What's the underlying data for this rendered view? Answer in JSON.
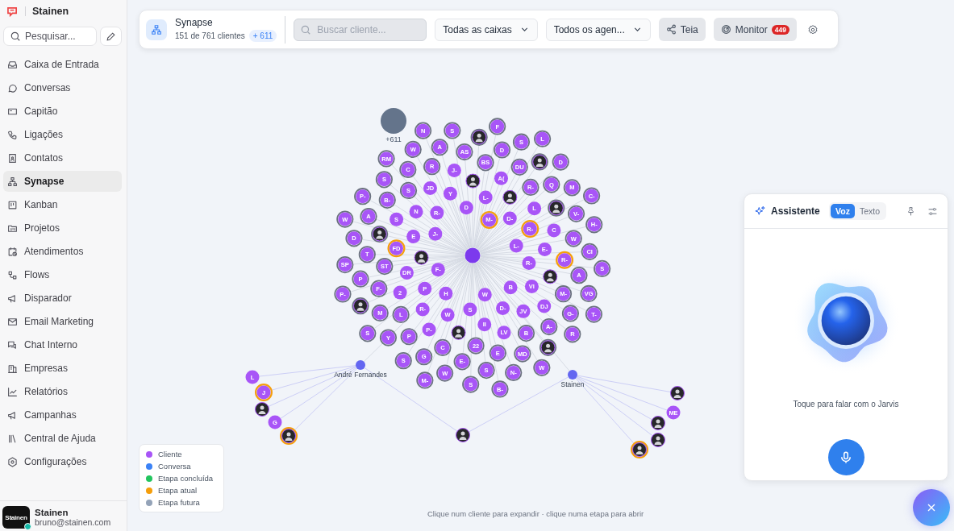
{
  "sidebar": {
    "brand": "Stainen",
    "search": {
      "placeholder": "Pesquisar..."
    },
    "items": [
      {
        "label": "Caixa de Entrada",
        "selected": false
      },
      {
        "label": "Conversas",
        "selected": false
      },
      {
        "label": "Capitão",
        "selected": false
      },
      {
        "label": "Ligações",
        "selected": false
      },
      {
        "label": "Contatos",
        "selected": false
      },
      {
        "label": "Synapse",
        "selected": true
      },
      {
        "label": "Kanban",
        "selected": false
      },
      {
        "label": "Projetos",
        "selected": false
      },
      {
        "label": "Atendimentos",
        "selected": false
      },
      {
        "label": "Flows",
        "selected": false
      },
      {
        "label": "Disparador",
        "selected": false
      },
      {
        "label": "Email Marketing",
        "selected": false
      },
      {
        "label": "Chat Interno",
        "selected": false
      },
      {
        "label": "Empresas",
        "selected": false
      },
      {
        "label": "Relatórios",
        "selected": false
      },
      {
        "label": "Campanhas",
        "selected": false
      },
      {
        "label": "Central de Ajuda",
        "selected": false
      },
      {
        "label": "Configurações",
        "selected": false
      }
    ],
    "user": {
      "logo": "Stainen",
      "name": "Stainen",
      "email": "bruno@stainen.com",
      "online": true
    }
  },
  "toolbar": {
    "title": "Synapse",
    "subtitle": "151 de 761 clientes",
    "badge": "+ 611",
    "search": {
      "placeholder": "Buscar cliente..."
    },
    "filters": [
      "Todas as caixas",
      "Todos os agen..."
    ],
    "buttons": [
      {
        "label": "Teia",
        "kind": "share"
      },
      {
        "label": "Monitor",
        "kind": "monitor",
        "count": "449"
      }
    ]
  },
  "graph": {
    "hidden_group": "+611",
    "clients": [
      {
        "label": "F",
        "kind": "letter",
        "current": false
      },
      {
        "label": "N",
        "kind": "letter",
        "current": false
      },
      {
        "label": "S",
        "kind": "letter",
        "current": false
      },
      {
        "kind": "avatar",
        "current": false
      },
      {
        "label": "L",
        "kind": "letter",
        "current": false
      },
      {
        "label": "W",
        "kind": "letter",
        "current": false
      },
      {
        "label": "A",
        "kind": "letter",
        "current": false
      },
      {
        "label": "AS",
        "kind": "letter",
        "current": false
      },
      {
        "label": "D",
        "kind": "letter",
        "current": false
      },
      {
        "label": "S",
        "kind": "letter",
        "current": false
      },
      {
        "label": "RM",
        "kind": "letter",
        "current": false
      },
      {
        "label": "BS",
        "kind": "letter",
        "current": false
      },
      {
        "kind": "avatar",
        "current": false
      },
      {
        "label": "D",
        "kind": "letter",
        "current": false
      },
      {
        "label": "C",
        "kind": "letter",
        "current": false
      },
      {
        "label": "R",
        "kind": "letter",
        "current": false
      },
      {
        "label": "J-",
        "kind": "letter",
        "current": false
      },
      {
        "label": "DU",
        "kind": "letter",
        "current": false
      },
      {
        "label": "S",
        "kind": "letter",
        "current": false
      },
      {
        "kind": "avatar",
        "current": false
      },
      {
        "label": "A(",
        "kind": "letter",
        "current": false
      },
      {
        "label": "Q",
        "kind": "letter",
        "current": false
      },
      {
        "label": "P-",
        "kind": "letter",
        "current": false
      },
      {
        "label": "S",
        "kind": "letter",
        "current": false
      },
      {
        "label": "JD",
        "kind": "letter",
        "current": false
      },
      {
        "label": "Y",
        "kind": "letter",
        "current": false
      },
      {
        "label": "L-",
        "kind": "letter",
        "current": false
      },
      {
        "kind": "avatar",
        "current": false
      },
      {
        "label": "R-",
        "kind": "letter",
        "current": false
      },
      {
        "label": "M",
        "kind": "letter",
        "current": false
      },
      {
        "label": "C-",
        "kind": "letter",
        "current": false
      },
      {
        "label": "B-",
        "kind": "letter",
        "current": false
      },
      {
        "label": "D",
        "kind": "letter",
        "current": false
      },
      {
        "label": "L",
        "kind": "letter",
        "current": false
      },
      {
        "kind": "avatar",
        "current": false
      },
      {
        "label": "W",
        "kind": "letter",
        "current": false
      },
      {
        "label": "A",
        "kind": "letter",
        "current": false
      },
      {
        "label": "S",
        "kind": "letter",
        "current": false
      },
      {
        "label": "N",
        "kind": "letter",
        "current": false
      },
      {
        "label": "R-",
        "kind": "letter",
        "current": false
      },
      {
        "label": "M-",
        "kind": "letter",
        "current": true
      },
      {
        "label": "D-",
        "kind": "letter",
        "current": false
      },
      {
        "label": "V-",
        "kind": "letter",
        "current": false
      },
      {
        "label": "R-",
        "kind": "letter",
        "current": true
      },
      {
        "label": "C",
        "kind": "letter",
        "current": false
      },
      {
        "label": "H-",
        "kind": "letter",
        "current": false
      },
      {
        "label": "D",
        "kind": "letter",
        "current": false
      },
      {
        "kind": "avatar",
        "current": false
      },
      {
        "label": "E",
        "kind": "letter",
        "current": false
      },
      {
        "label": "J-",
        "kind": "letter",
        "current": false
      },
      {
        "label": "W",
        "kind": "letter",
        "current": false
      },
      {
        "label": "FD",
        "kind": "letter",
        "current": true
      },
      {
        "label": "L-",
        "kind": "letter",
        "current": false
      },
      {
        "label": "E-",
        "kind": "letter",
        "current": false
      },
      {
        "label": "CI",
        "kind": "letter",
        "current": false
      },
      {
        "label": "SP",
        "kind": "letter",
        "current": false
      },
      {
        "label": "T",
        "kind": "letter",
        "current": false
      },
      {
        "kind": "avatar",
        "current": false
      },
      {
        "label": "R-",
        "kind": "letter",
        "current": false
      },
      {
        "label": "R-",
        "kind": "letter",
        "current": true
      },
      {
        "label": "ST",
        "kind": "letter",
        "current": false
      },
      {
        "label": "DR",
        "kind": "letter",
        "current": false
      },
      {
        "label": "F-",
        "kind": "letter",
        "current": false
      },
      {
        "label": "A",
        "kind": "letter",
        "current": false
      },
      {
        "label": "S",
        "kind": "letter",
        "current": false
      },
      {
        "label": "P",
        "kind": "letter",
        "current": false
      },
      {
        "label": "B",
        "kind": "letter",
        "current": false
      },
      {
        "label": "VI",
        "kind": "letter",
        "current": false
      },
      {
        "kind": "avatar",
        "current": false
      },
      {
        "label": "P-",
        "kind": "letter",
        "current": false
      },
      {
        "label": "F-",
        "kind": "letter",
        "current": false
      },
      {
        "label": "2",
        "kind": "letter",
        "current": false
      },
      {
        "label": "P",
        "kind": "letter",
        "current": false
      },
      {
        "label": "H",
        "kind": "letter",
        "current": false
      },
      {
        "label": "W",
        "kind": "letter",
        "current": false
      },
      {
        "label": "M-",
        "kind": "letter",
        "current": false
      },
      {
        "label": "VG",
        "kind": "letter",
        "current": false
      },
      {
        "kind": "avatar",
        "current": false
      },
      {
        "label": "R-",
        "kind": "letter",
        "current": false
      },
      {
        "label": "S",
        "kind": "letter",
        "current": false
      },
      {
        "label": "D-",
        "kind": "letter",
        "current": false
      },
      {
        "label": "DJ",
        "kind": "letter",
        "current": false
      },
      {
        "label": "M",
        "kind": "letter",
        "current": false
      },
      {
        "label": "L",
        "kind": "letter",
        "current": false
      },
      {
        "label": "W",
        "kind": "letter",
        "current": false
      },
      {
        "label": "JV",
        "kind": "letter",
        "current": false
      },
      {
        "label": "G-",
        "kind": "letter",
        "current": false
      },
      {
        "label": "T-",
        "kind": "letter",
        "current": false
      },
      {
        "label": "P-",
        "kind": "letter",
        "current": false
      },
      {
        "kind": "avatar",
        "current": false
      },
      {
        "label": "II",
        "kind": "letter",
        "current": false
      },
      {
        "label": "LV",
        "kind": "letter",
        "current": false
      },
      {
        "label": "A-",
        "kind": "letter",
        "current": false
      },
      {
        "label": "S",
        "kind": "letter",
        "current": false
      },
      {
        "label": "Y",
        "kind": "letter",
        "current": false
      },
      {
        "label": "P",
        "kind": "letter",
        "current": false
      },
      {
        "label": "B",
        "kind": "letter",
        "current": false
      },
      {
        "label": "R",
        "kind": "letter",
        "current": false
      },
      {
        "label": "C",
        "kind": "letter",
        "current": false
      },
      {
        "label": "22",
        "kind": "letter",
        "current": false
      },
      {
        "label": "E",
        "kind": "letter",
        "current": false
      },
      {
        "label": "MD",
        "kind": "letter",
        "current": false
      },
      {
        "kind": "avatar",
        "current": false
      },
      {
        "label": "S",
        "kind": "letter",
        "current": false
      },
      {
        "label": "G",
        "kind": "letter",
        "current": false
      },
      {
        "label": "E-",
        "kind": "letter",
        "current": false
      },
      {
        "label": "W",
        "kind": "letter",
        "current": false
      },
      {
        "label": "S",
        "kind": "letter",
        "current": false
      },
      {
        "label": "N-",
        "kind": "letter",
        "current": false
      },
      {
        "label": "W",
        "kind": "letter",
        "current": false
      },
      {
        "label": "M-",
        "kind": "letter",
        "current": false
      },
      {
        "label": "S",
        "kind": "letter",
        "current": false
      },
      {
        "label": "B-",
        "kind": "letter",
        "current": false
      }
    ],
    "agents": [
      {
        "name": "André Fernandes",
        "clients": [
          {
            "label": "L",
            "kind": "letter",
            "current": false
          },
          {
            "label": "J",
            "kind": "letter",
            "current": true
          },
          {
            "kind": "avatar",
            "current": false
          },
          {
            "label": "G",
            "kind": "letter",
            "current": false
          },
          {
            "kind": "avatar",
            "current": true
          }
        ]
      },
      {
        "name": "Stainen",
        "clients": [
          {
            "kind": "avatar",
            "current": false
          },
          {
            "label": "ME",
            "kind": "letter",
            "current": false
          },
          {
            "kind": "avatar",
            "current": false
          },
          {
            "kind": "avatar",
            "current": false
          },
          {
            "kind": "avatar",
            "current": true
          }
        ]
      }
    ],
    "shared_clients": [
      {
        "kind": "avatar",
        "current": false
      }
    ]
  },
  "legend": [
    {
      "label": "Cliente",
      "color": "#a855f7"
    },
    {
      "label": "Conversa",
      "color": "#3b82f6"
    },
    {
      "label": "Etapa concluída",
      "color": "#22c55e"
    },
    {
      "label": "Etapa atual",
      "color": "#f59e0b"
    },
    {
      "label": "Etapa futura",
      "color": "#94a3b8"
    }
  ],
  "hint": "Clique num cliente para expandir · clique numa etapa para abrir",
  "assistant": {
    "title": "Assistente",
    "modes": [
      {
        "label": "Voz",
        "selected": true
      },
      {
        "label": "Texto",
        "selected": false
      }
    ],
    "prompt": "Toque para falar com o Jarvis"
  }
}
